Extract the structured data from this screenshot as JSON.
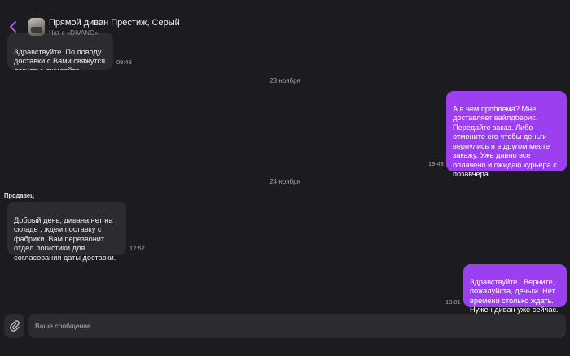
{
  "header": {
    "title": "Прямой диван Престиж, Серый",
    "subtitle": "Чат с «DIVANO»"
  },
  "icons": {
    "back": "chevron-left-icon",
    "attach": "paperclip-icon"
  },
  "colors": {
    "background": "#1c1b1f",
    "incoming_bubble": "#2c2b30",
    "outgoing_bubble": "#9b3ff0",
    "accent": "#9b3ff0"
  },
  "messages": [
    {
      "direction": "in",
      "text": "Здравствуйте. По поводу\nдоставки с Вами свяжутся\nлогисты, ожидайте",
      "time": "09:48"
    },
    {
      "type": "date",
      "label": "23 ноября"
    },
    {
      "direction": "out",
      "text": "А в чем проблема? Мне\nдоставляет вайлдберис.\nПередайте заказ. Либо\nотмените его чтобы деньги\nвернулись я в другом месте\nзакажу. Уже давно все\nоплачено и ожидаю курьера с\nпозавчера",
      "time": "19:43"
    },
    {
      "type": "date",
      "label": "24 ноября"
    },
    {
      "direction": "in",
      "sender": "Продавец",
      "text": "Добрый день, дивана нет на\nскладе , ждем поставку с\nфабрики. Вам перезвонит\nотдел логистики для\nсогласования даты доставки.",
      "time": "12:57"
    },
    {
      "direction": "out",
      "text": "Здравствуйте . Верните,\nпожалуйста, деньги. Нет\nвремени столько ждать.\nНужен диван уже сейчас.",
      "time": "13:01"
    }
  ],
  "composer": {
    "placeholder": "Ваше сообщение"
  }
}
